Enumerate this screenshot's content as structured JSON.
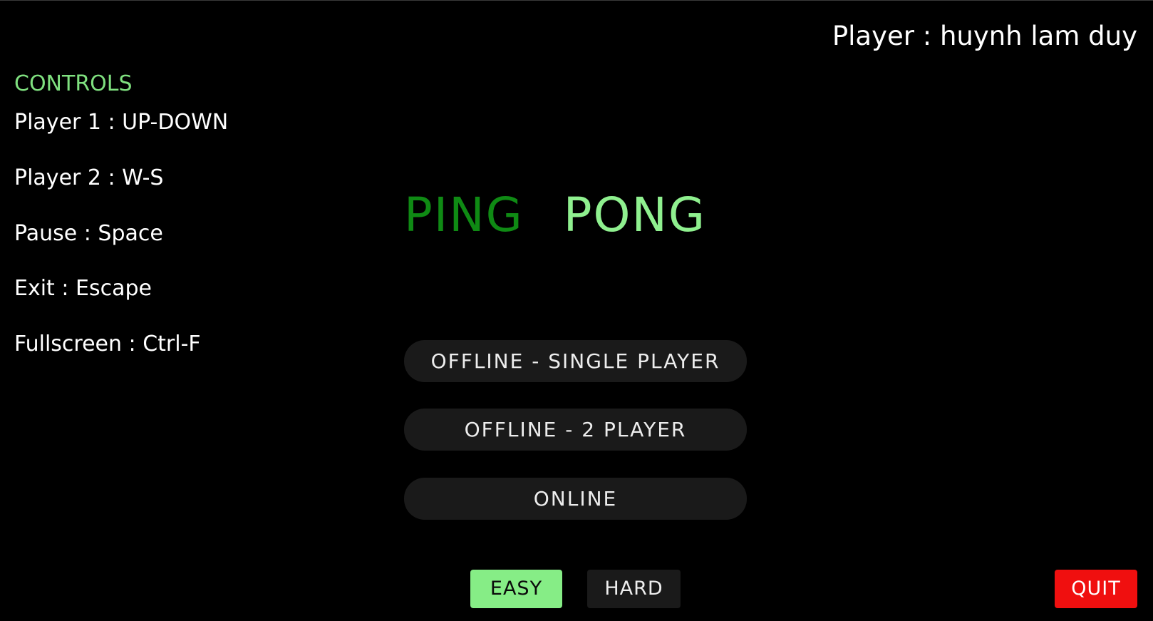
{
  "player": {
    "label": "Player : huynh lam duy"
  },
  "controls": {
    "title": "CONTROLS",
    "lines": [
      "Player 1 : UP-DOWN",
      "Player 2 : W-S",
      "Pause : Space",
      "Exit : Escape",
      "Fullscreen : Ctrl-F"
    ]
  },
  "title": {
    "ping": "PING",
    "pong": "PONG"
  },
  "menu": {
    "single_player": "OFFLINE - SINGLE PLAYER",
    "two_player": "OFFLINE - 2 PLAYER",
    "online": "ONLINE"
  },
  "difficulty": {
    "easy": "EASY",
    "hard": "HARD",
    "selected": "EASY"
  },
  "quit_label": "QUIT",
  "colors": {
    "background": "#000000",
    "accent_green": "#86ed86",
    "dark_green": "#0f8a14",
    "button_bg": "#1a1a1a",
    "quit_red": "#f00f0f"
  }
}
